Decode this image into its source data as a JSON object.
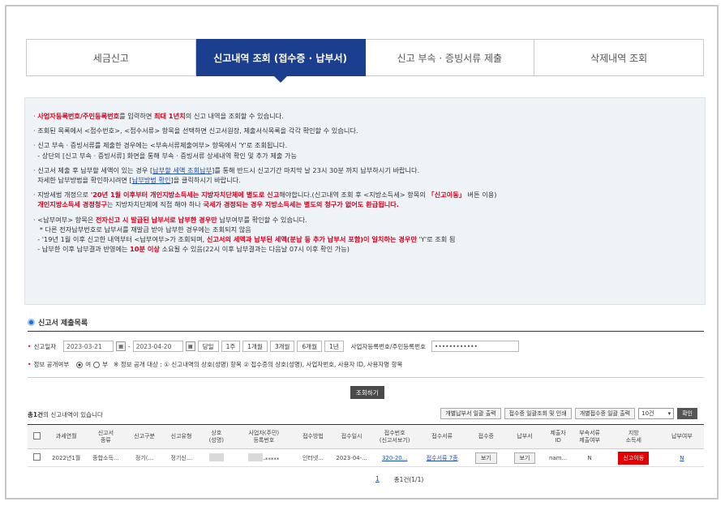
{
  "tabs": [
    {
      "label": "세금신고"
    },
    {
      "label": "신고내역 조회 (접수증 · 납부서)"
    },
    {
      "label": "신고 부속 · 증빙서류 제출"
    },
    {
      "label": "삭제내역 조회"
    }
  ],
  "notice": {
    "l1a": "사업자등록번호/주민등록번호",
    "l1b": "를 입력하면 ",
    "l1c": "최대 1년치",
    "l1d": "의 신고 내역을 조회할 수 있습니다.",
    "l2": "조회된 목록에서 <접수번호>, <접수서류> 항목을 선택하면 신고서원장, 제출서식목록을 각각 확인할 수 있습니다.",
    "l3a": "신고 부속 · 증빙서류를 제출한 경우에는 <부속서류제출여부> 항목에서 'Y'로 조회됩니다.",
    "l3b": "- 상단의 [신고 부속 · 증빙서류] 화면을 통해 부속 · 증빙서류 상세내역 확인 및 추가 제출 가능",
    "l4a": "신고서 제출 후 납부할 세액이 있는 경우 [",
    "l4b": "납부할 세액 조회납부",
    "l4c": "]를 통해 반드시 신고기간 마지막 날 23시 30분 까지 납부하시기 바랍니다.",
    "l4d": "자세한 납부방법을 확인하시려면 [",
    "l4e": "납부방법 확인",
    "l4f": "]을 클릭하시기 바랍니다.",
    "l5a": "지방세법 개정으로 ",
    "l5b": "'20년 1월 이후부터 개인지방소득세는 지방자치단체에 별도로 신고",
    "l5c": "해야합니다.(신고내역 조회 후 <지방소득세> 항목의 ",
    "l5d": "「신고이동」",
    "l5e": " 버튼 이용)",
    "l5f": "개인지방소득세 경정청구",
    "l5g": "는 지방자치단체에 직접 해야 하나 ",
    "l5h": "국세가 경정되는 경우 지방소득세는 별도의 청구가 없어도 환급됩니다.",
    "l6a": "<납부여부> 항목은 ",
    "l6b": "전자신고 시 발급된 납부서로 납부한 경우만",
    "l6c": " 납부여부를 확인할 수 있습니다.",
    "l6d": "* 다른 전자납부번호로 납부서를 재발급 받아 납부한 경우에는 조회되지 않음",
    "l6e": "- '19년 1월 이후 신고한 내역부터 <납부여부>가 조회되며, ",
    "l6f": "신고서의 세액과 납부된 세액(분납 등 추가 납부서 포함)이 일치하는 경우만",
    "l6g": " 'Y'로 조회 됨",
    "l6h": "- 납부한 이후 납부결과 반영에는 ",
    "l6i": "10분 이상",
    "l6j": " 소요될 수 있음(22시 이후 납부결과는 다음날 07시 이후 확인 가능)"
  },
  "section_title": "신고서 제출목록",
  "search": {
    "date_label": "신고일자",
    "date_from": "2023-03-21",
    "date_sep": "-",
    "date_to": "2023-04-20",
    "periods": [
      "당일",
      "1주",
      "1개월",
      "3개월",
      "6개월",
      "1년"
    ],
    "id_label": "사업자등록번호/주민등록번호",
    "id_value": "••••••••••••",
    "public_label": "정보 공개여부",
    "yes": "여",
    "no": "부",
    "public_note": "※ 정보 공개 대상 : ① 신고내역의 상호(성명) 항목 ② 접수증의 상호(성명), 사업자번호, 사용자 ID, 사용자명 항목",
    "submit": "조회하기"
  },
  "result": {
    "count_bold": "총1건",
    "count_rest": "의 신고내역이 있습니다",
    "btn1": "개별납부서 일괄 출력",
    "btn2": "접수증 일괄조회 및 인쇄",
    "btn3": "개별접수증 일괄 출력",
    "per_page": "10건",
    "ok": "확인"
  },
  "table": {
    "headers": [
      "과세연월",
      "신고서\n종류",
      "신고구분",
      "신고유형",
      "상호\n(성명)",
      "사업자(주민)\n등록번호",
      "접수방법",
      "접수일시",
      "접수번호\n(신고서보기)",
      "접수서류",
      "접수증",
      "납부서",
      "제출자\nID",
      "부속서류\n제출여부",
      "지방\n소득세",
      "납부여부"
    ],
    "row": {
      "period": "2022년1월",
      "kind": "종합소득...",
      "div": "정기(...",
      "type": "정기신...",
      "regno": "-*****",
      "method": "인터넷...",
      "datetime": "2023-04-...",
      "receipt_no": "320-20...",
      "docs": "접수서류 7종",
      "view1": "보기",
      "view2": "보기",
      "submitter": "nam...",
      "attach": "N",
      "local_tax": "신고이동",
      "paid": "N"
    }
  },
  "pager": {
    "current": "1",
    "summary": "총1건(1/1)"
  }
}
